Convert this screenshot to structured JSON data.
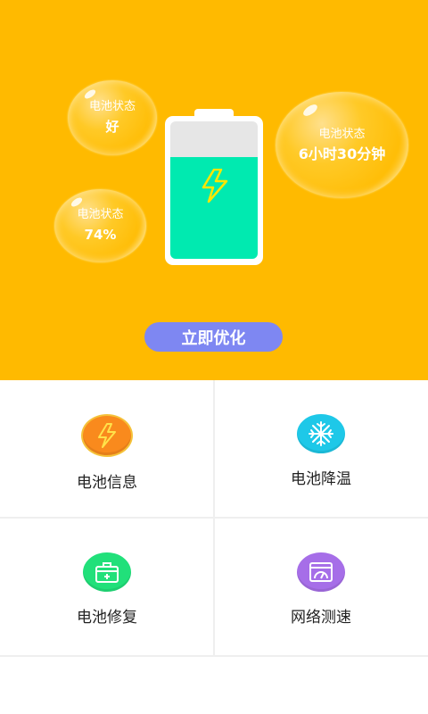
{
  "hero": {
    "background": "#FFBA00",
    "bubbles": [
      {
        "label": "电池状态",
        "value": "好"
      },
      {
        "label": "电池状态",
        "value": "74%"
      },
      {
        "label": "电池状态",
        "value": "6小时30分钟"
      }
    ],
    "battery": {
      "level_fraction": 0.74,
      "fill_color": "#00EAB0",
      "icon": "lightning-bolt-icon"
    },
    "optimize_button": {
      "label": "立即优化",
      "color": "#7E87F2"
    }
  },
  "tiles": [
    {
      "label": "电池信息",
      "icon": "lightning-icon",
      "color": "#F98A1D"
    },
    {
      "label": "电池降温",
      "icon": "snowflake-icon",
      "color": "#1EC8E8"
    },
    {
      "label": "电池修复",
      "icon": "toolbox-icon",
      "color": "#21E07A"
    },
    {
      "label": "网络测速",
      "icon": "speed-gauge-icon",
      "color": "#A66EE8"
    }
  ]
}
